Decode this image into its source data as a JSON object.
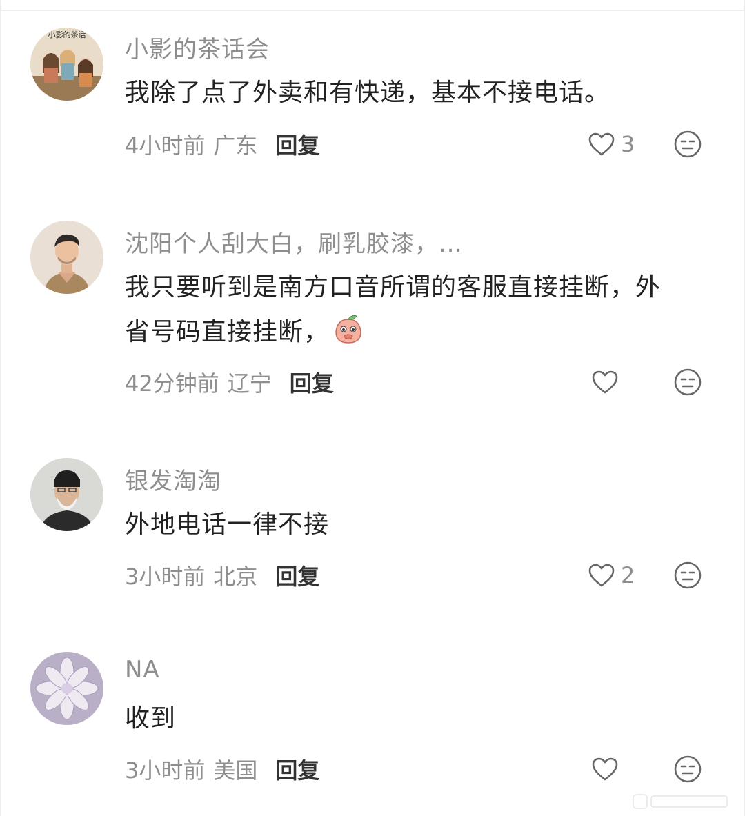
{
  "comments": [
    {
      "username": "小影的茶话会",
      "avatar_text": "小影的茶话",
      "content": "我除了点了外卖和有快递，基本不接电话。",
      "time": "4小时前",
      "location": "广东",
      "reply_label": "回复",
      "likes": "3"
    },
    {
      "username": "沈阳个人刮大白，刷乳胶漆，…",
      "content_line1": "我只要听到是南方口音所谓的客服直接挂断，外",
      "content_line2": "省号码直接挂断，",
      "emoji": "peach-shy-emoji",
      "time": "42分钟前",
      "location": "辽宁",
      "reply_label": "回复",
      "likes": ""
    },
    {
      "username": "银发淘淘",
      "content": "外地电话一律不接",
      "time": "3小时前",
      "location": "北京",
      "reply_label": "回复",
      "likes": "2"
    },
    {
      "username": "NA",
      "content": "收到",
      "time": "3小时前",
      "location": "美国",
      "reply_label": "回复",
      "likes": ""
    }
  ],
  "icons": {
    "like": "heart-outline-icon",
    "dislike": "neutral-face-icon"
  },
  "colors": {
    "username": "#8e8e8e",
    "content": "#222222",
    "reply": "#333333",
    "background": "#ffffff"
  }
}
